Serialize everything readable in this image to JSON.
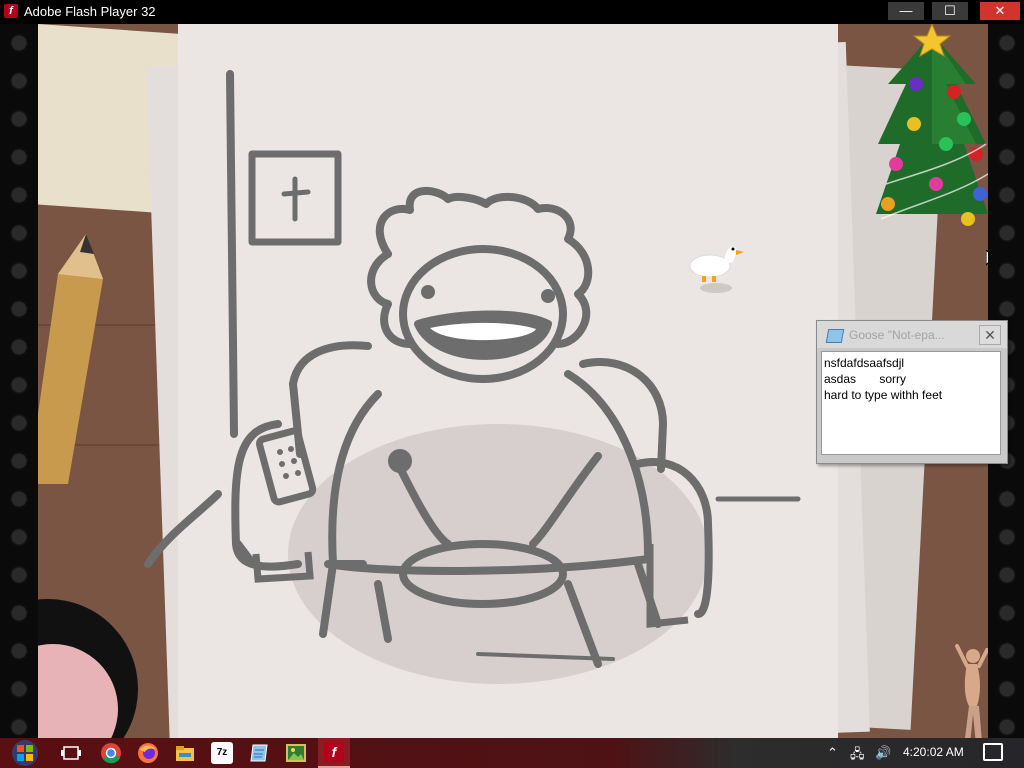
{
  "window": {
    "title": "Adobe Flash Player 32",
    "app_icon_glyph": "f",
    "min_glyph": "—",
    "max_glyph": "☐",
    "close_glyph": "✕"
  },
  "note_window": {
    "title": "Goose \"Not-epa...",
    "close_glyph": "✕",
    "lines": [
      "nsfdafdsaafsdjl",
      "asdas       sorry",
      "hard to type withh feet"
    ]
  },
  "taskbar": {
    "apps": [
      "task-view-icon",
      "chrome-icon",
      "firefox-icon",
      "file-explorer-icon",
      "7zip-icon",
      "notepad-icon",
      "image-viewer-icon",
      "flash-player-icon"
    ],
    "app_7zip_label": "7z",
    "tray_chevron": "⌃",
    "tray_network": "🖧",
    "tray_volume": "🔊",
    "clock": "4:20:02 AM"
  },
  "colors": {
    "titlebar": "#000000",
    "close_button": "#d0342c",
    "desk": "#7a5544",
    "paper": "#ebe6e4",
    "ink": "#6b6b6b",
    "taskbar": "#5a0f12"
  }
}
